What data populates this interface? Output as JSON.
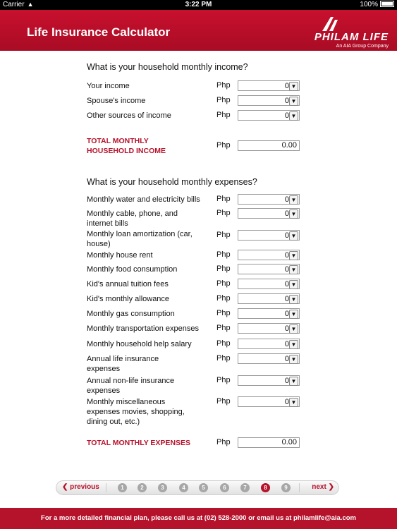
{
  "status": {
    "carrier": "Carrier",
    "time": "3:22 PM",
    "battery": "100%"
  },
  "header": {
    "title": "Life Insurance Calculator",
    "logo_name": "PHILAM LIFE",
    "logo_sub": "An AIA Group Company"
  },
  "income": {
    "question": "What is your household monthly income?",
    "currency": "Php",
    "items": [
      {
        "label": "Your income",
        "value": "0"
      },
      {
        "label": "Spouse's income",
        "value": "0"
      },
      {
        "label": "Other sources of income",
        "value": "0"
      }
    ],
    "total_label": "TOTAL MONTHLY HOUSEHOLD INCOME",
    "total_value": "0.00"
  },
  "expenses": {
    "question": "What is your household monthly expenses?",
    "currency": "Php",
    "items": [
      {
        "label": "Monthly water and electricity bills",
        "value": "0"
      },
      {
        "label": "Monthly cable, phone, and internet bills",
        "value": "0"
      },
      {
        "label": "Monthly loan amortization (car, house)",
        "value": "0"
      },
      {
        "label": "Monthly house rent",
        "value": "0"
      },
      {
        "label": "Monthly food consumption",
        "value": "0"
      },
      {
        "label": "Kid's annual tuition fees",
        "value": "0"
      },
      {
        "label": "Kid's monthly allowance",
        "value": "0"
      },
      {
        "label": "Monthly gas consumption",
        "value": "0"
      },
      {
        "label": "Monthly transportation expenses",
        "value": "0"
      },
      {
        "label": "Monthly household help salary",
        "value": "0"
      },
      {
        "label": "Annual life insurance expenses",
        "value": "0"
      },
      {
        "label": "Annual non-life insurance expenses",
        "value": "0"
      },
      {
        "label": "Monthly miscellaneous expenses movies, shopping, dining out, etc.)",
        "value": "0"
      }
    ],
    "total_label": "TOTAL MONTHLY EXPENSES",
    "total_value": "0.00"
  },
  "pager": {
    "prev_label": "previous",
    "next_label": "next",
    "pages": [
      "1",
      "2",
      "3",
      "4",
      "5",
      "6",
      "7",
      "8",
      "9"
    ],
    "current": "8"
  },
  "footer": {
    "text": "For a more detailed financial plan, please call us at (02) 528-2000 or email us at philamlife@aia.com"
  }
}
